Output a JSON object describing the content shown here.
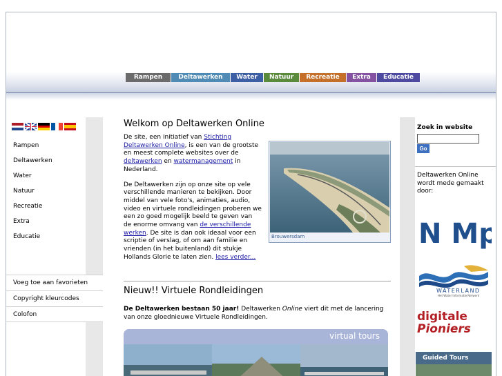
{
  "topnav": {
    "items": [
      {
        "label": "Rampen",
        "color": "#6b6b6b"
      },
      {
        "label": "Deltawerken",
        "color": "#4f8bb4"
      },
      {
        "label": "Water",
        "color": "#3d5fa3"
      },
      {
        "label": "Natuur",
        "color": "#5a8a3c"
      },
      {
        "label": "Recreatie",
        "color": "#c4702a"
      },
      {
        "label": "Extra",
        "color": "#8452a0"
      },
      {
        "label": "Educatie",
        "color": "#4d4aa0"
      }
    ]
  },
  "languages": [
    "nl",
    "en",
    "de",
    "fr",
    "es"
  ],
  "leftnav": {
    "items": [
      "Rampen",
      "Deltawerken",
      "Water",
      "Natuur",
      "Recreatie",
      "Extra",
      "Educatie"
    ],
    "extra": [
      "Voeg toe aan favorieten",
      "Copyright kleurcodes",
      "Colofon"
    ]
  },
  "main": {
    "title": "Welkom op Deltawerken Online",
    "p1_a": "De site, een initiatief van ",
    "p1_link1": "Stichting Deltawerken Online",
    "p1_b": ", is een van de grootste en meest complete websites over de ",
    "p1_link2": "deltawerken",
    "p1_c": " en ",
    "p1_link3": "watermanagement",
    "p1_d": " in Nederland.",
    "p2_a": "De Deltawerken zijn op onze site op vele verschillende manieren te bekijken. Door middel van vele foto's, animaties, audio, video en virtuele rondleidingen proberen we een zo goed mogelijk beeld te geven van de enorme omvang van ",
    "p2_link1": "de verschillende werken",
    "p2_b": ". De site is dan ook ideaal voor een scriptie of verslag, of om aan familie en vrienden (in het buitenland) dit stukje Hollands Glorie te laten zien. ",
    "p2_link2": "lees verder...",
    "photo_caption": "Brouwersdam",
    "subtitle": "Nieuw!! Virtuele Rondleidingen",
    "vr_bold": "De Deltawerken bestaan 50 jaar!",
    "vr_a": " Deltawerken ",
    "vr_italic": "Online",
    "vr_b": " viert dit met de lancering van onze gloednieuwe Virtuele Rondleidingen.",
    "vtours_label": "virtual tours"
  },
  "right": {
    "search_label": "Zoek in website",
    "search_value": "",
    "go_label": "Go",
    "made_by": "Deltawerken Online wordt mede gemaakt door:",
    "logo_nmp": "N Mp",
    "logo_waterland": "WATERLAND",
    "logo_waterland_sub": "Het Water Informatie Netwerk",
    "logo_dp_1": "digitale",
    "logo_dp_2": "Pioniers",
    "logo_gt": "Guided Tours"
  }
}
